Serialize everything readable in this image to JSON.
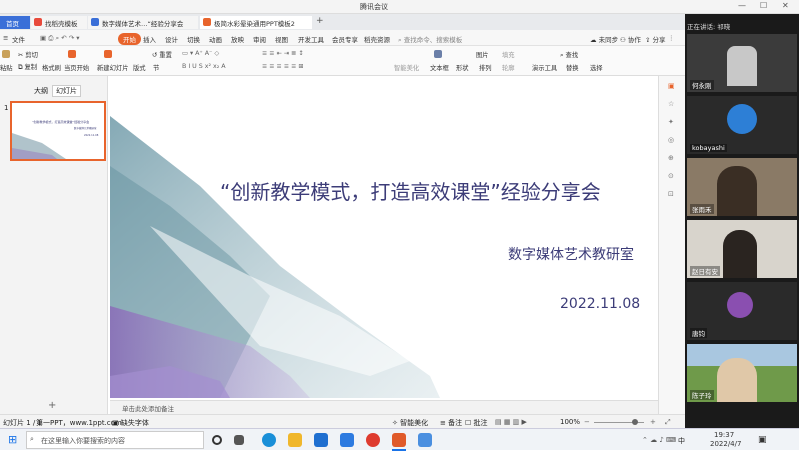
{
  "window": {
    "title": "腾讯会议"
  },
  "tabs": [
    {
      "label": "首页"
    },
    {
      "label": "找稻壳模板"
    },
    {
      "label": "数字媒体艺术…“经验分享会"
    },
    {
      "label": "极简水彩晕染通用PPT模板2"
    }
  ],
  "menubar": {
    "file": "文件",
    "items": [
      "开始",
      "插入",
      "设计",
      "切换",
      "动画",
      "放映",
      "审阅",
      "视图",
      "开发工具",
      "会员专享",
      "稻壳资源"
    ],
    "search_placeholder": "查找命令、搜索模板",
    "sync": "未同步",
    "collab": "协作",
    "share": "分享"
  },
  "ribbon": {
    "paste": "粘贴",
    "cut": "剪切",
    "copy": "复制",
    "format_painter": "格式刷",
    "from_start": "当页开始",
    "new_slide": "新建幻灯片",
    "layout": "版式",
    "section": "节",
    "reset": "重置",
    "smart_beautify": "智能美化",
    "textbox": "文本框",
    "shape": "形状",
    "arrange": "排列",
    "outline": "轮廓",
    "picture": "图片",
    "fill": "填充",
    "presentation_tool": "演示工具",
    "replace": "替换",
    "select": "选择",
    "find": "查找"
  },
  "leftpanel": {
    "tab_outline": "大纲",
    "tab_slides": "幻灯片",
    "slide_number": "1",
    "add_slide": "+"
  },
  "slide": {
    "title": "“创新教学模式，打造高效课堂”经验分享会",
    "subtitle": "数字媒体艺术教研室",
    "date": "2022.11.08"
  },
  "notes": {
    "placeholder": "单击此处添加备注"
  },
  "statusbar": {
    "slide_info": "幻灯片 1 / 1",
    "theme": "第一PPT，www.1ppt.com",
    "missing_font": "缺失字体",
    "beautify": "智能美化",
    "notes": "备注",
    "comments": "批注",
    "zoom": "100%"
  },
  "meeting": {
    "speaking": "正在讲话: 祁晓",
    "participants": [
      "何永刚",
      "kobayashi",
      "张雨禾",
      "赵日有安",
      "唐钧",
      "陈子玲"
    ]
  },
  "taskbar": {
    "search_placeholder": "在这里输入你要搜索的内容",
    "time": "19:37",
    "date": "2022/4/7",
    "lang": "中"
  },
  "colors": {
    "accent": "#e8642c",
    "wps_blue": "#3a6fd8",
    "slide_title": "#3c3c78"
  }
}
